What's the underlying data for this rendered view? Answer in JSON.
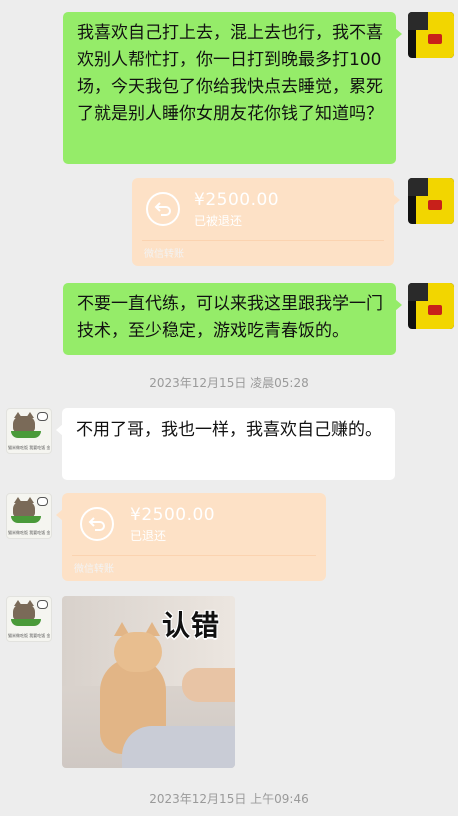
{
  "messages": [
    {
      "sender": "self",
      "type": "text",
      "text": "我喜欢自己打上去，混上去也行，我不喜欢别人帮忙打，你一日打到晚最多打100场，今天我包了你给我快点去睡觉，累死了就是别人睡你女朋友花你钱了知道吗？"
    },
    {
      "sender": "self",
      "type": "transfer",
      "amount": "¥2500.00",
      "status": "已被退还",
      "footer": "微信转账"
    },
    {
      "sender": "self",
      "type": "text",
      "text": "不要一直代练，可以来我这里跟我学一门技术，至少稳定，游戏吃青春饭的。"
    },
    {
      "type": "timestamp",
      "text": "2023年12月15日 凌晨05:28"
    },
    {
      "sender": "peer",
      "type": "text",
      "text": "不用了哥，我也一样，我喜欢自己赚的。"
    },
    {
      "sender": "peer",
      "type": "transfer",
      "amount": "¥2500.00",
      "status": "已退还",
      "footer": "微信转账"
    },
    {
      "sender": "peer",
      "type": "sticker",
      "caption": "认错"
    },
    {
      "type": "timestamp",
      "text": "2023年12月15日 上午09:46"
    }
  ],
  "avatars": {
    "self": {
      "icon": "yellow-profile-avatar"
    },
    "peer": {
      "icon": "cat-eating-avatar",
      "caption": "猫米做吃饭 我要吃饭 金饭"
    }
  },
  "colors": {
    "background": "#ededed",
    "self_bubble": "#95ec69",
    "peer_bubble": "#ffffff",
    "transfer_returned": "#fde1c6",
    "timestamp": "#9a9a9a"
  },
  "icons": {
    "transfer": "return-arrow-icon"
  }
}
